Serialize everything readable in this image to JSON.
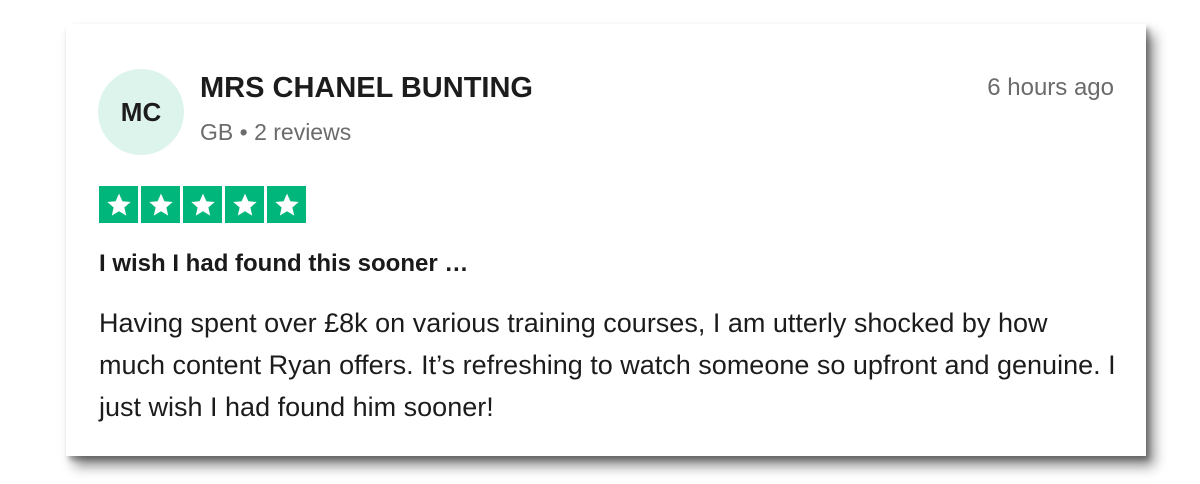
{
  "review": {
    "avatar_initials": "MC",
    "reviewer_name": "MRS CHANEL BUNTING",
    "reviewer_meta": "GB • 2 reviews",
    "timestamp": "6 hours ago",
    "rating": 5,
    "rating_max": 5,
    "star_color": "#00b67a",
    "title": "I wish I had found this sooner …",
    "body": "Having spent over £8k on various training courses, I am utterly shocked by how much content Ryan offers. It’s refreshing to watch someone so upfront and genuine. I just wish I had found him sooner!"
  }
}
